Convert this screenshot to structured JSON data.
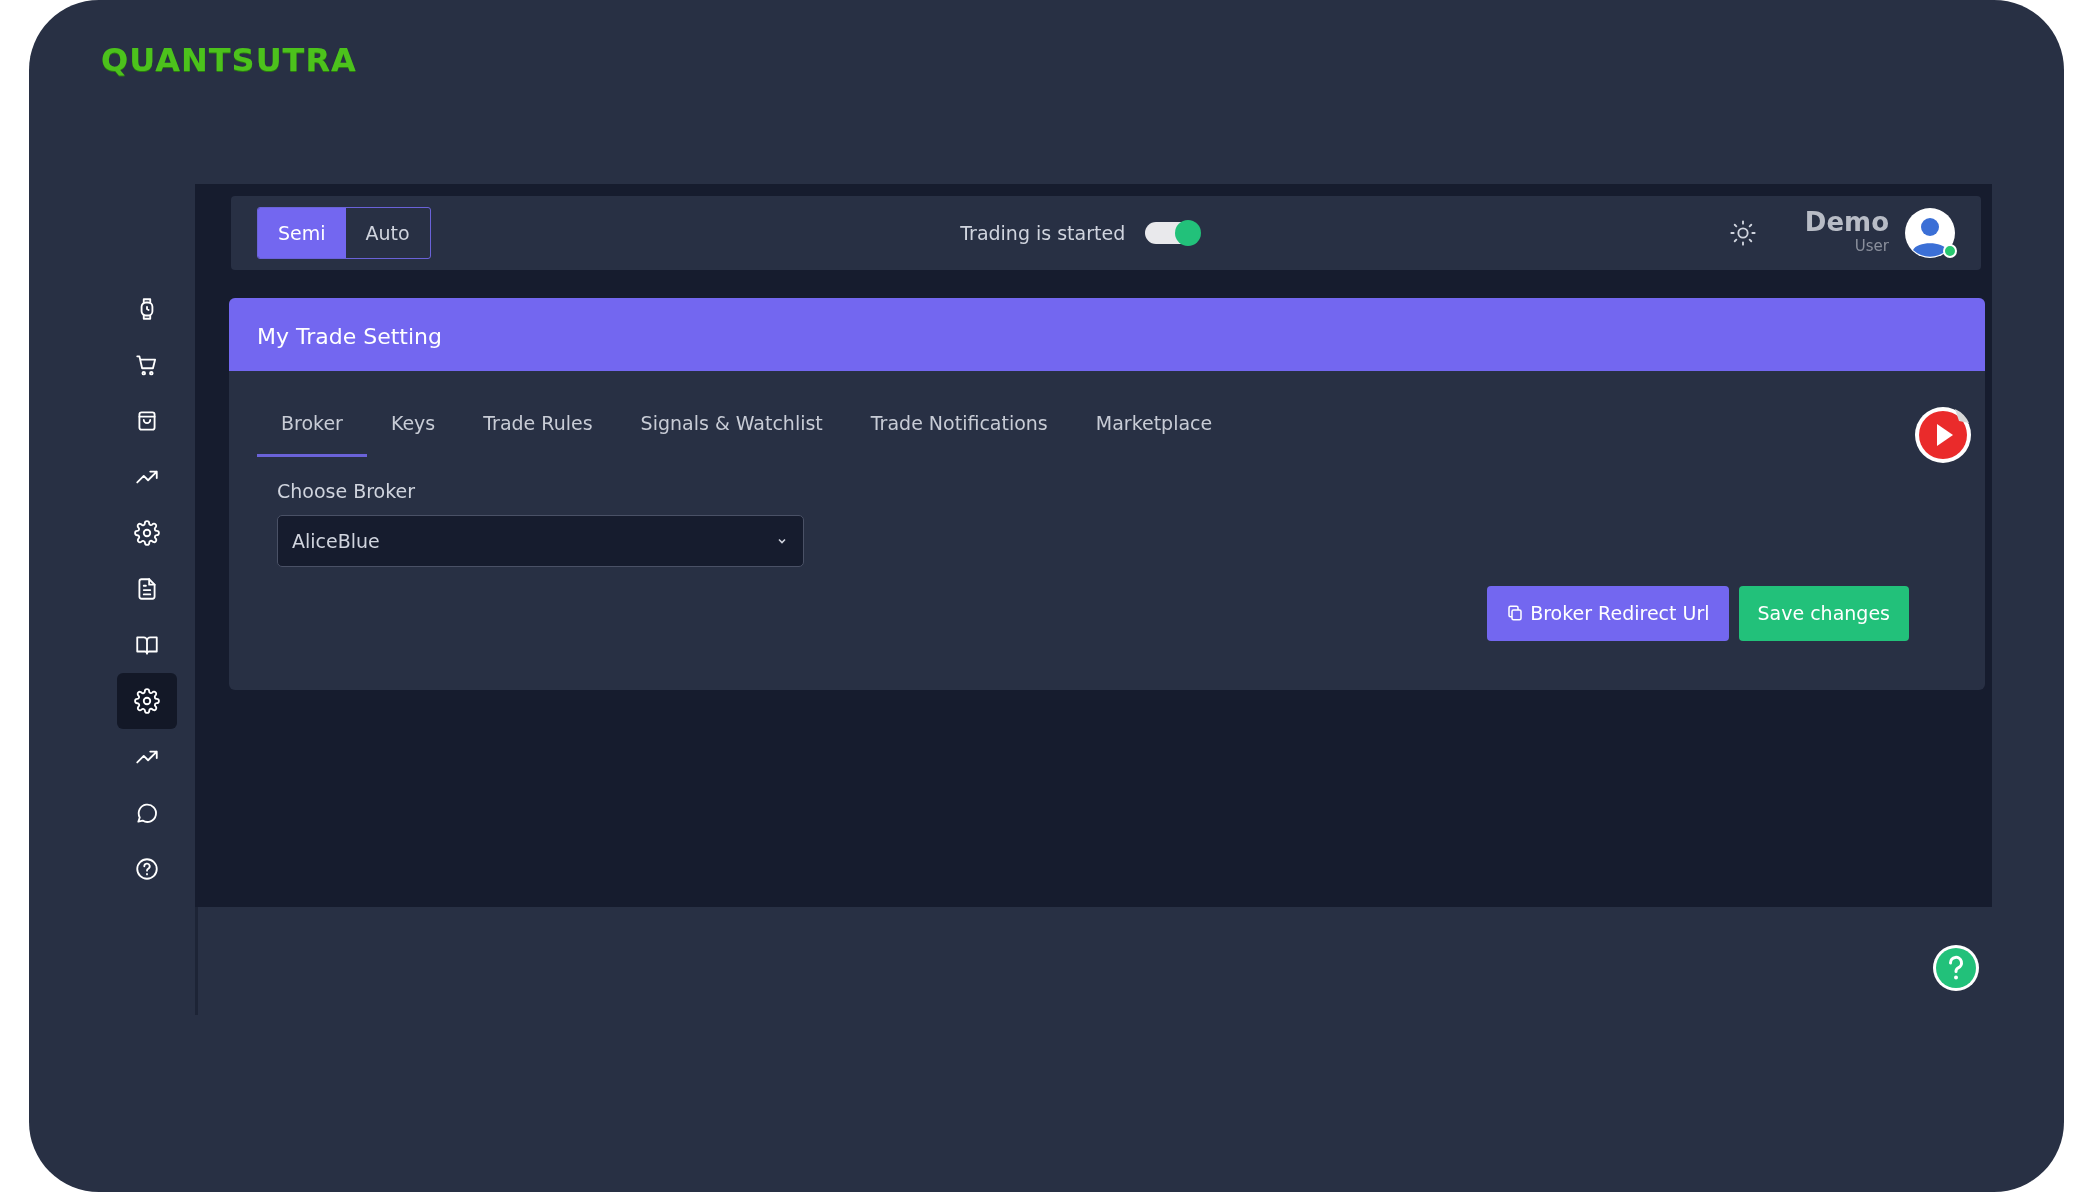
{
  "logo": {
    "text": "QUANTSUTRA"
  },
  "sidebar": {
    "items": [
      {
        "kind": "watch",
        "selected": false
      },
      {
        "kind": "cart",
        "selected": false
      },
      {
        "kind": "bag",
        "selected": false
      },
      {
        "kind": "trend",
        "selected": false
      },
      {
        "kind": "gear",
        "selected": false
      },
      {
        "kind": "document",
        "selected": false
      },
      {
        "kind": "book",
        "selected": false
      },
      {
        "kind": "gear",
        "selected": true
      },
      {
        "kind": "trend",
        "selected": false
      },
      {
        "kind": "chat",
        "selected": false
      },
      {
        "kind": "help",
        "selected": false
      }
    ]
  },
  "topbar": {
    "mode_tabs": [
      {
        "label": "Semi",
        "selected": true
      },
      {
        "label": "Auto",
        "selected": false
      }
    ],
    "trading_label": "Trading is started",
    "trading_on": true,
    "user": {
      "name": "Demo",
      "role": "User",
      "online": true
    }
  },
  "card": {
    "title": "My Trade Setting",
    "tabs": [
      {
        "label": "Broker",
        "selected": true
      },
      {
        "label": "Keys",
        "selected": false
      },
      {
        "label": "Trade Rules",
        "selected": false
      },
      {
        "label": "Signals & Watchlist",
        "selected": false
      },
      {
        "label": "Trade Notifications",
        "selected": false
      },
      {
        "label": "Marketplace",
        "selected": false
      }
    ],
    "field": {
      "label": "Choose Broker",
      "value": "AliceBlue"
    },
    "buttons": [
      {
        "label": "Broker Redirect Url",
        "kind": "primary"
      },
      {
        "label": "Save changes",
        "kind": "success"
      }
    ]
  }
}
